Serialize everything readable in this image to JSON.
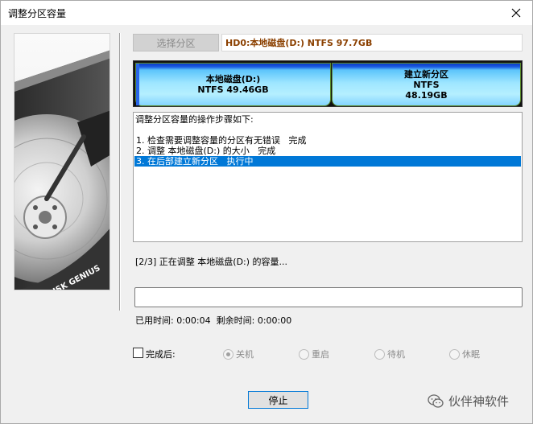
{
  "window": {
    "title": "调整分区容量"
  },
  "side_image": {
    "logo_text": "DISK GENIUS"
  },
  "partition": {
    "select_label": "选择分区",
    "disk_info": "HD0:本地磁盘(D:) NTFS 97.7GB"
  },
  "partitions": [
    {
      "line1": "本地磁盘(D:)",
      "line2": "NTFS 49.46GB"
    },
    {
      "line1": "建立新分区",
      "line2": "NTFS",
      "line3": "48.19GB"
    }
  ],
  "steps": {
    "heading": "调整分区容量的操作步骤如下:",
    "items": [
      "1. 检查需要调整容量的分区有无错误   完成",
      "2. 调整 本地磁盘(D:) 的大小   完成",
      "3. 在后部建立新分区   执行中"
    ],
    "active_index": 2
  },
  "status": {
    "text": "[2/3] 正在调整 本地磁盘(D:) 的容量..."
  },
  "progress": {
    "fraction": 0.0
  },
  "timing": {
    "elapsed_label": "已用时间:",
    "elapsed_value": "0:00:04",
    "remaining_label": "剩余时间:",
    "remaining_value": "0:00:00"
  },
  "after": {
    "label": "完成后:",
    "checked": false,
    "options": [
      "关机",
      "重启",
      "待机",
      "休眠"
    ],
    "selected_index": 0
  },
  "buttons": {
    "stop": "停止"
  },
  "watermark": {
    "text": "伙伴神软件"
  },
  "colors": {
    "accent": "#0078d7",
    "disk_info_text": "#8b4000",
    "partition_fill": "#9ee6ff"
  }
}
